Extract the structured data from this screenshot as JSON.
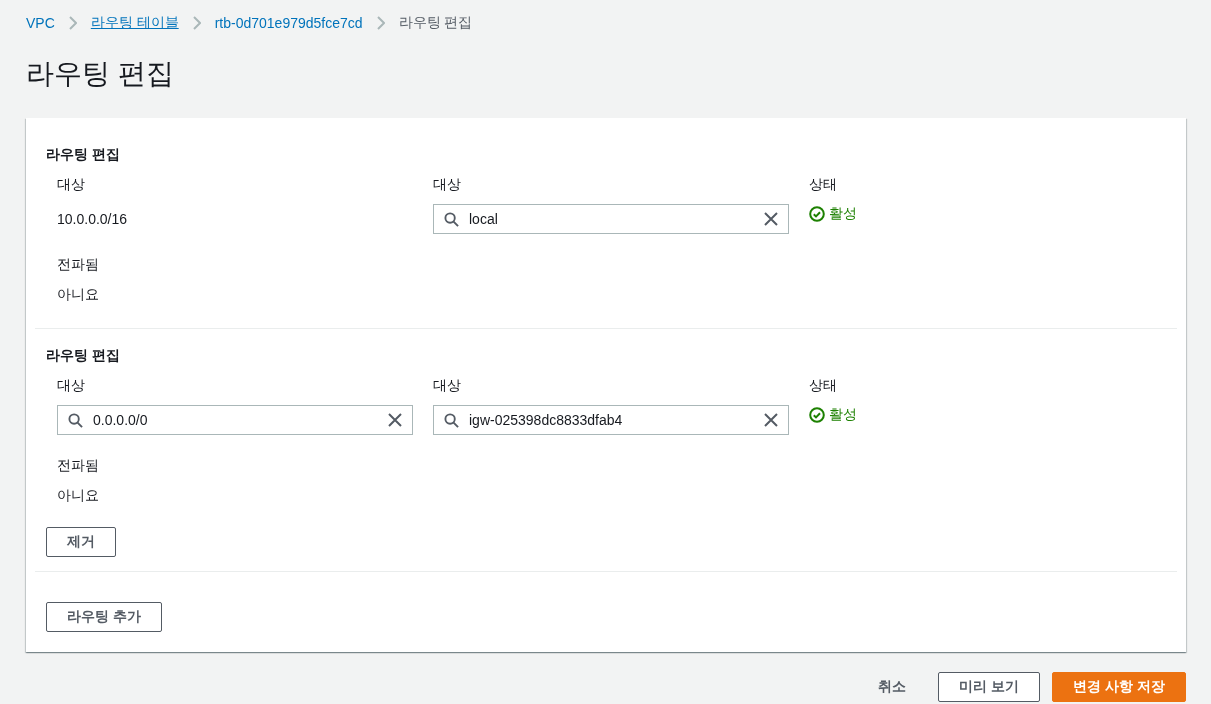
{
  "breadcrumbs": [
    {
      "label": "VPC",
      "kind": "link"
    },
    {
      "label": "라우팅 테이블",
      "kind": "underlined"
    },
    {
      "label": "rtb-0d701e979d5fce7cd",
      "kind": "link"
    },
    {
      "label": "라우팅 편집",
      "kind": "current"
    }
  ],
  "title": "라우팅 편집",
  "routes": [
    {
      "heading": "라우팅 편집",
      "destination": {
        "label": "대상",
        "kind": "text",
        "value": "10.0.0.0/16"
      },
      "target": {
        "label": "대상",
        "value": "local"
      },
      "status": {
        "label": "상태",
        "value": "활성"
      },
      "propagated": {
        "label": "전파됨",
        "value": "아니요"
      }
    },
    {
      "heading": "라우팅 편집",
      "destination": {
        "label": "대상",
        "kind": "field",
        "value": "0.0.0.0/0"
      },
      "target": {
        "label": "대상",
        "value": "igw-025398dc8833dfab4"
      },
      "status": {
        "label": "상태",
        "value": "활성"
      },
      "propagated": {
        "label": "전파됨",
        "value": "아니요"
      },
      "remove_button": "제거"
    }
  ],
  "add_button": "라우팅 추가",
  "footer": {
    "cancel": "취소",
    "preview": "미리 보기",
    "save": "변경 사항 저장"
  }
}
